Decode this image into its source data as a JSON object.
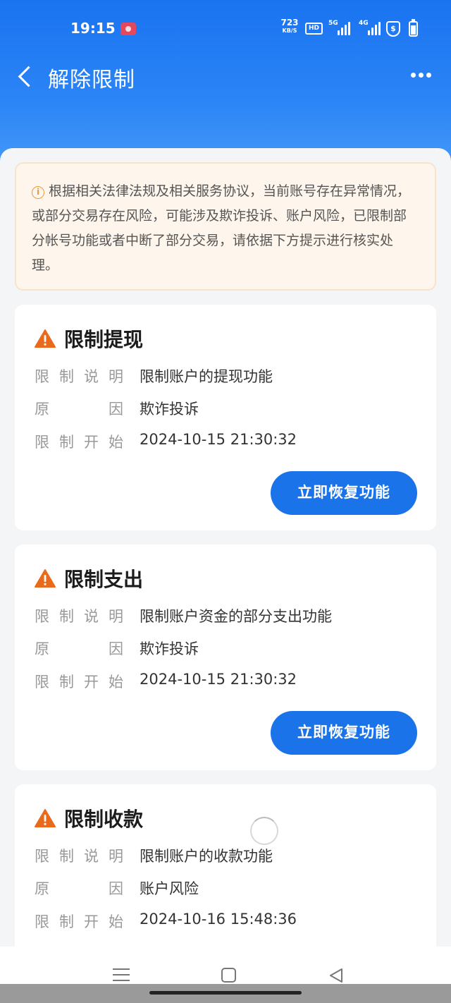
{
  "status_bar": {
    "time": "19:15",
    "net_speed": "723",
    "net_unit": "KB/S",
    "hd": "HD",
    "sim1": "5G",
    "sim2": "4G",
    "shield": "$"
  },
  "nav": {
    "title": "解除限制"
  },
  "notice": {
    "text": "根据相关法律法规及相关服务协议，当前账号存在异常情况，或部分交易存在风险，可能涉及欺诈投诉、账户风险，已限制部分帐号功能或者中断了部分交易，请依据下方提示进行核实处理。"
  },
  "labels": {
    "desc": [
      "限",
      "制",
      "说",
      "明"
    ],
    "reason": [
      "原",
      "因"
    ],
    "start": [
      "限",
      "制",
      "开",
      "始"
    ]
  },
  "cards": [
    {
      "title": "限制提现",
      "desc": "限制账户的提现功能",
      "reason": "欺诈投诉",
      "start": "2024-10-15 21:30:32",
      "button": "立即恢复功能"
    },
    {
      "title": "限制支出",
      "desc": "限制账户资金的部分支出功能",
      "reason": "欺诈投诉",
      "start": "2024-10-15 21:30:32",
      "button": "立即恢复功能"
    },
    {
      "title": "限制收款",
      "desc": "限制账户的收款功能",
      "reason": "账户风险",
      "start": "2024-10-16 15:48:36"
    }
  ],
  "colors": {
    "header_blue": "#1a73f0",
    "button_blue": "#1a73e8",
    "warning_orange": "#ea6a1c",
    "notice_bg": "#fef6ec"
  }
}
